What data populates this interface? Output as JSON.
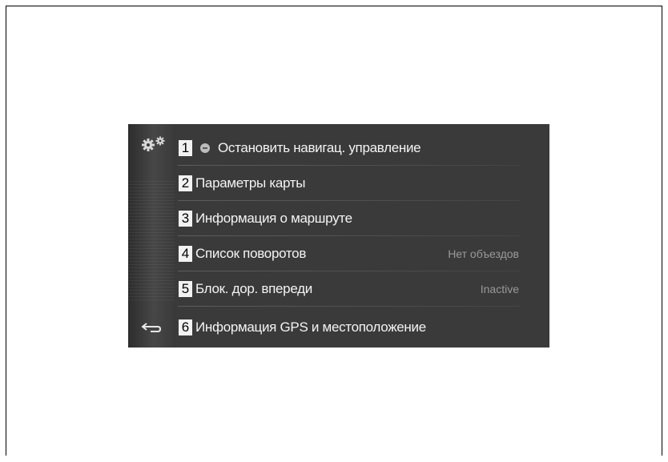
{
  "menu": {
    "items": [
      {
        "number": "1",
        "label": "Остановить навигац. управление",
        "value": ""
      },
      {
        "number": "2",
        "label": "Параметры карты",
        "value": ""
      },
      {
        "number": "3",
        "label": "Информация о маршруте",
        "value": ""
      },
      {
        "number": "4",
        "label": "Список поворотов",
        "value": "Нет объездов"
      },
      {
        "number": "5",
        "label": "Блок. дор. впереди",
        "value": "Inactive"
      },
      {
        "number": "6",
        "label": "Информация GPS и местоположение",
        "value": ""
      }
    ]
  },
  "icons": {
    "header": "gears-icon",
    "stop": "stop-route-icon",
    "back": "back-arrow-icon"
  },
  "colors": {
    "screen_bg": "#3a3a3a",
    "text": "#f4f4f4",
    "value_text": "#9a9a9a",
    "number_box": "#f2f2f2"
  }
}
